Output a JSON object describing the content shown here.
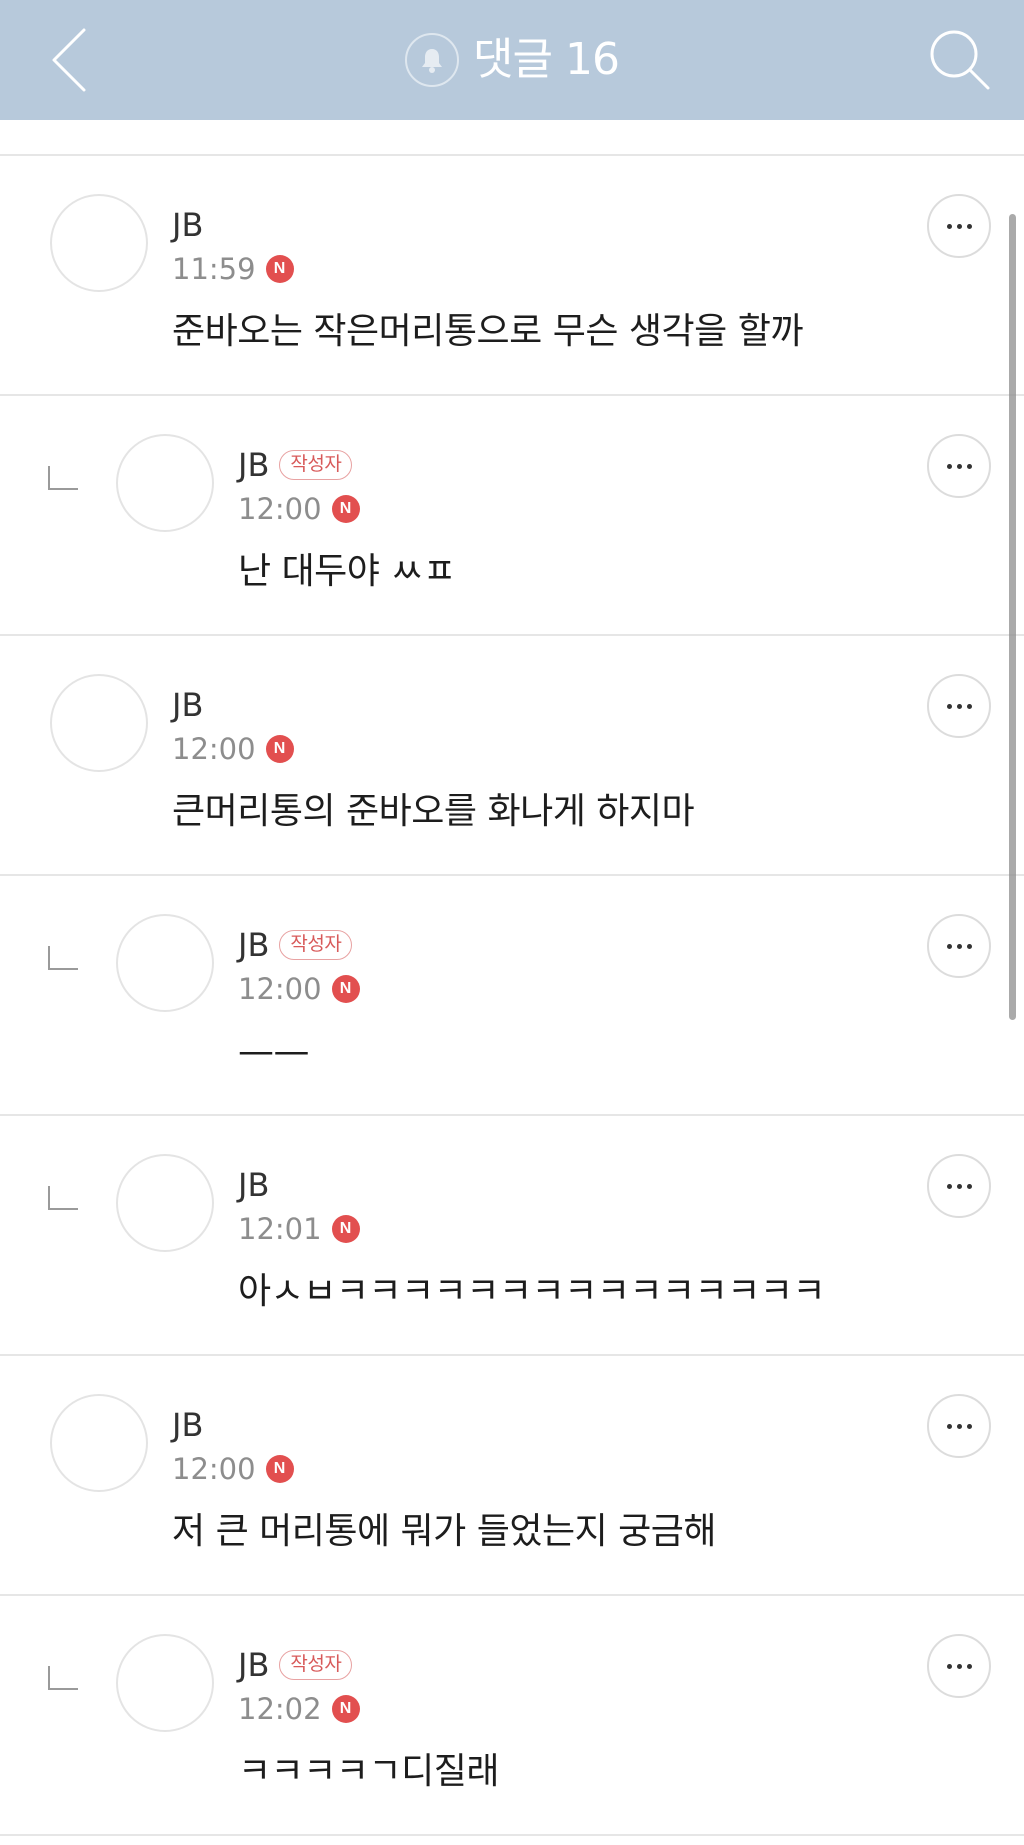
{
  "header": {
    "title": "댓글 16",
    "back_icon": "chevron-left-icon",
    "bell_icon": "bell-icon",
    "search_icon": "search-icon",
    "background_color": "#b7c9db"
  },
  "author_badge_label": "작성자",
  "new_badge_label": "N",
  "comments": [
    {
      "name": "JB",
      "time": "11:59",
      "text": "준바오는 작은머리통으로 무슨 생각을 할까"
    },
    {
      "name": "JB",
      "time": "12:00",
      "text": "난 대두야 ㅆㅍ"
    },
    {
      "name": "JB",
      "time": "12:00",
      "text": "큰머리통의 준바오를 화나게 하지마"
    },
    {
      "name": "JB",
      "time": "12:00",
      "text": "——"
    },
    {
      "name": "JB",
      "time": "12:01",
      "text": "아ㅅㅂㅋㅋㅋㅋㅋㅋㅋㅋㅋㅋㅋㅋㅋㅋㅋ"
    },
    {
      "name": "JB",
      "time": "12:00",
      "text": "저 큰 머리통에 뭐가 들었는지 궁금해"
    },
    {
      "name": "JB",
      "time": "12:02",
      "text": "ㅋㅋㅋㅋㄱ디질래"
    }
  ]
}
